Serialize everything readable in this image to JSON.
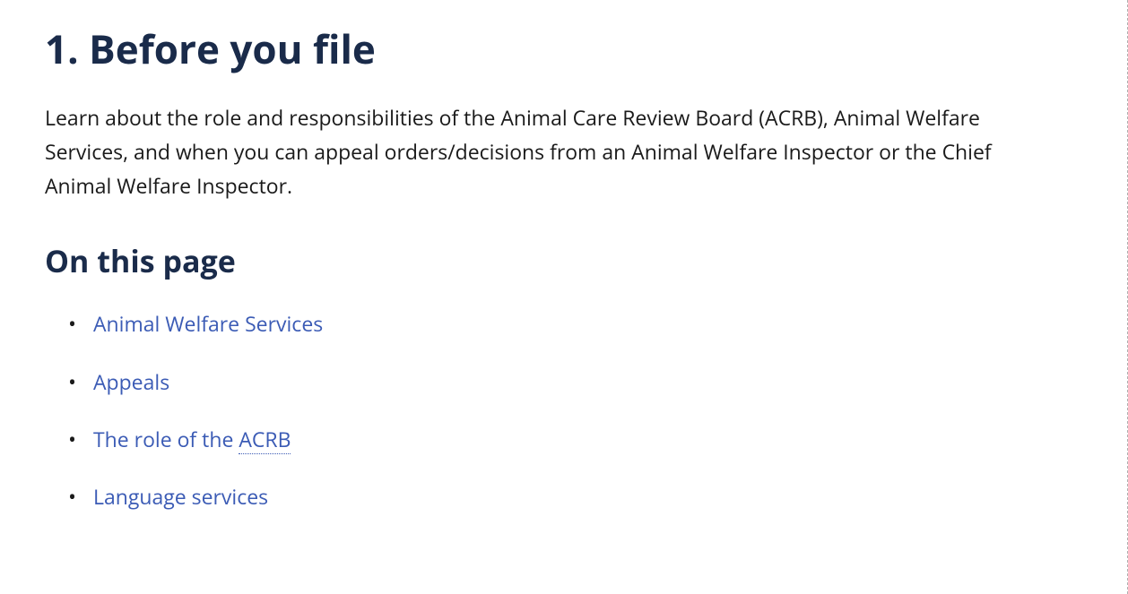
{
  "heading": "1. Before you file",
  "intro": "Learn about the role and responsibilities of the Animal Care Review Board (ACRB), Animal Welfare Services, and when you can appeal orders/decisions from an Animal Welfare Inspector or the Chief Animal Welfare Inspector.",
  "toc": {
    "title": "On this page",
    "items": [
      {
        "label": "Animal Welfare Services"
      },
      {
        "label": "Appeals"
      },
      {
        "prefix": "The role of the ",
        "abbr": "ACRB"
      },
      {
        "label": "Language services"
      }
    ]
  }
}
